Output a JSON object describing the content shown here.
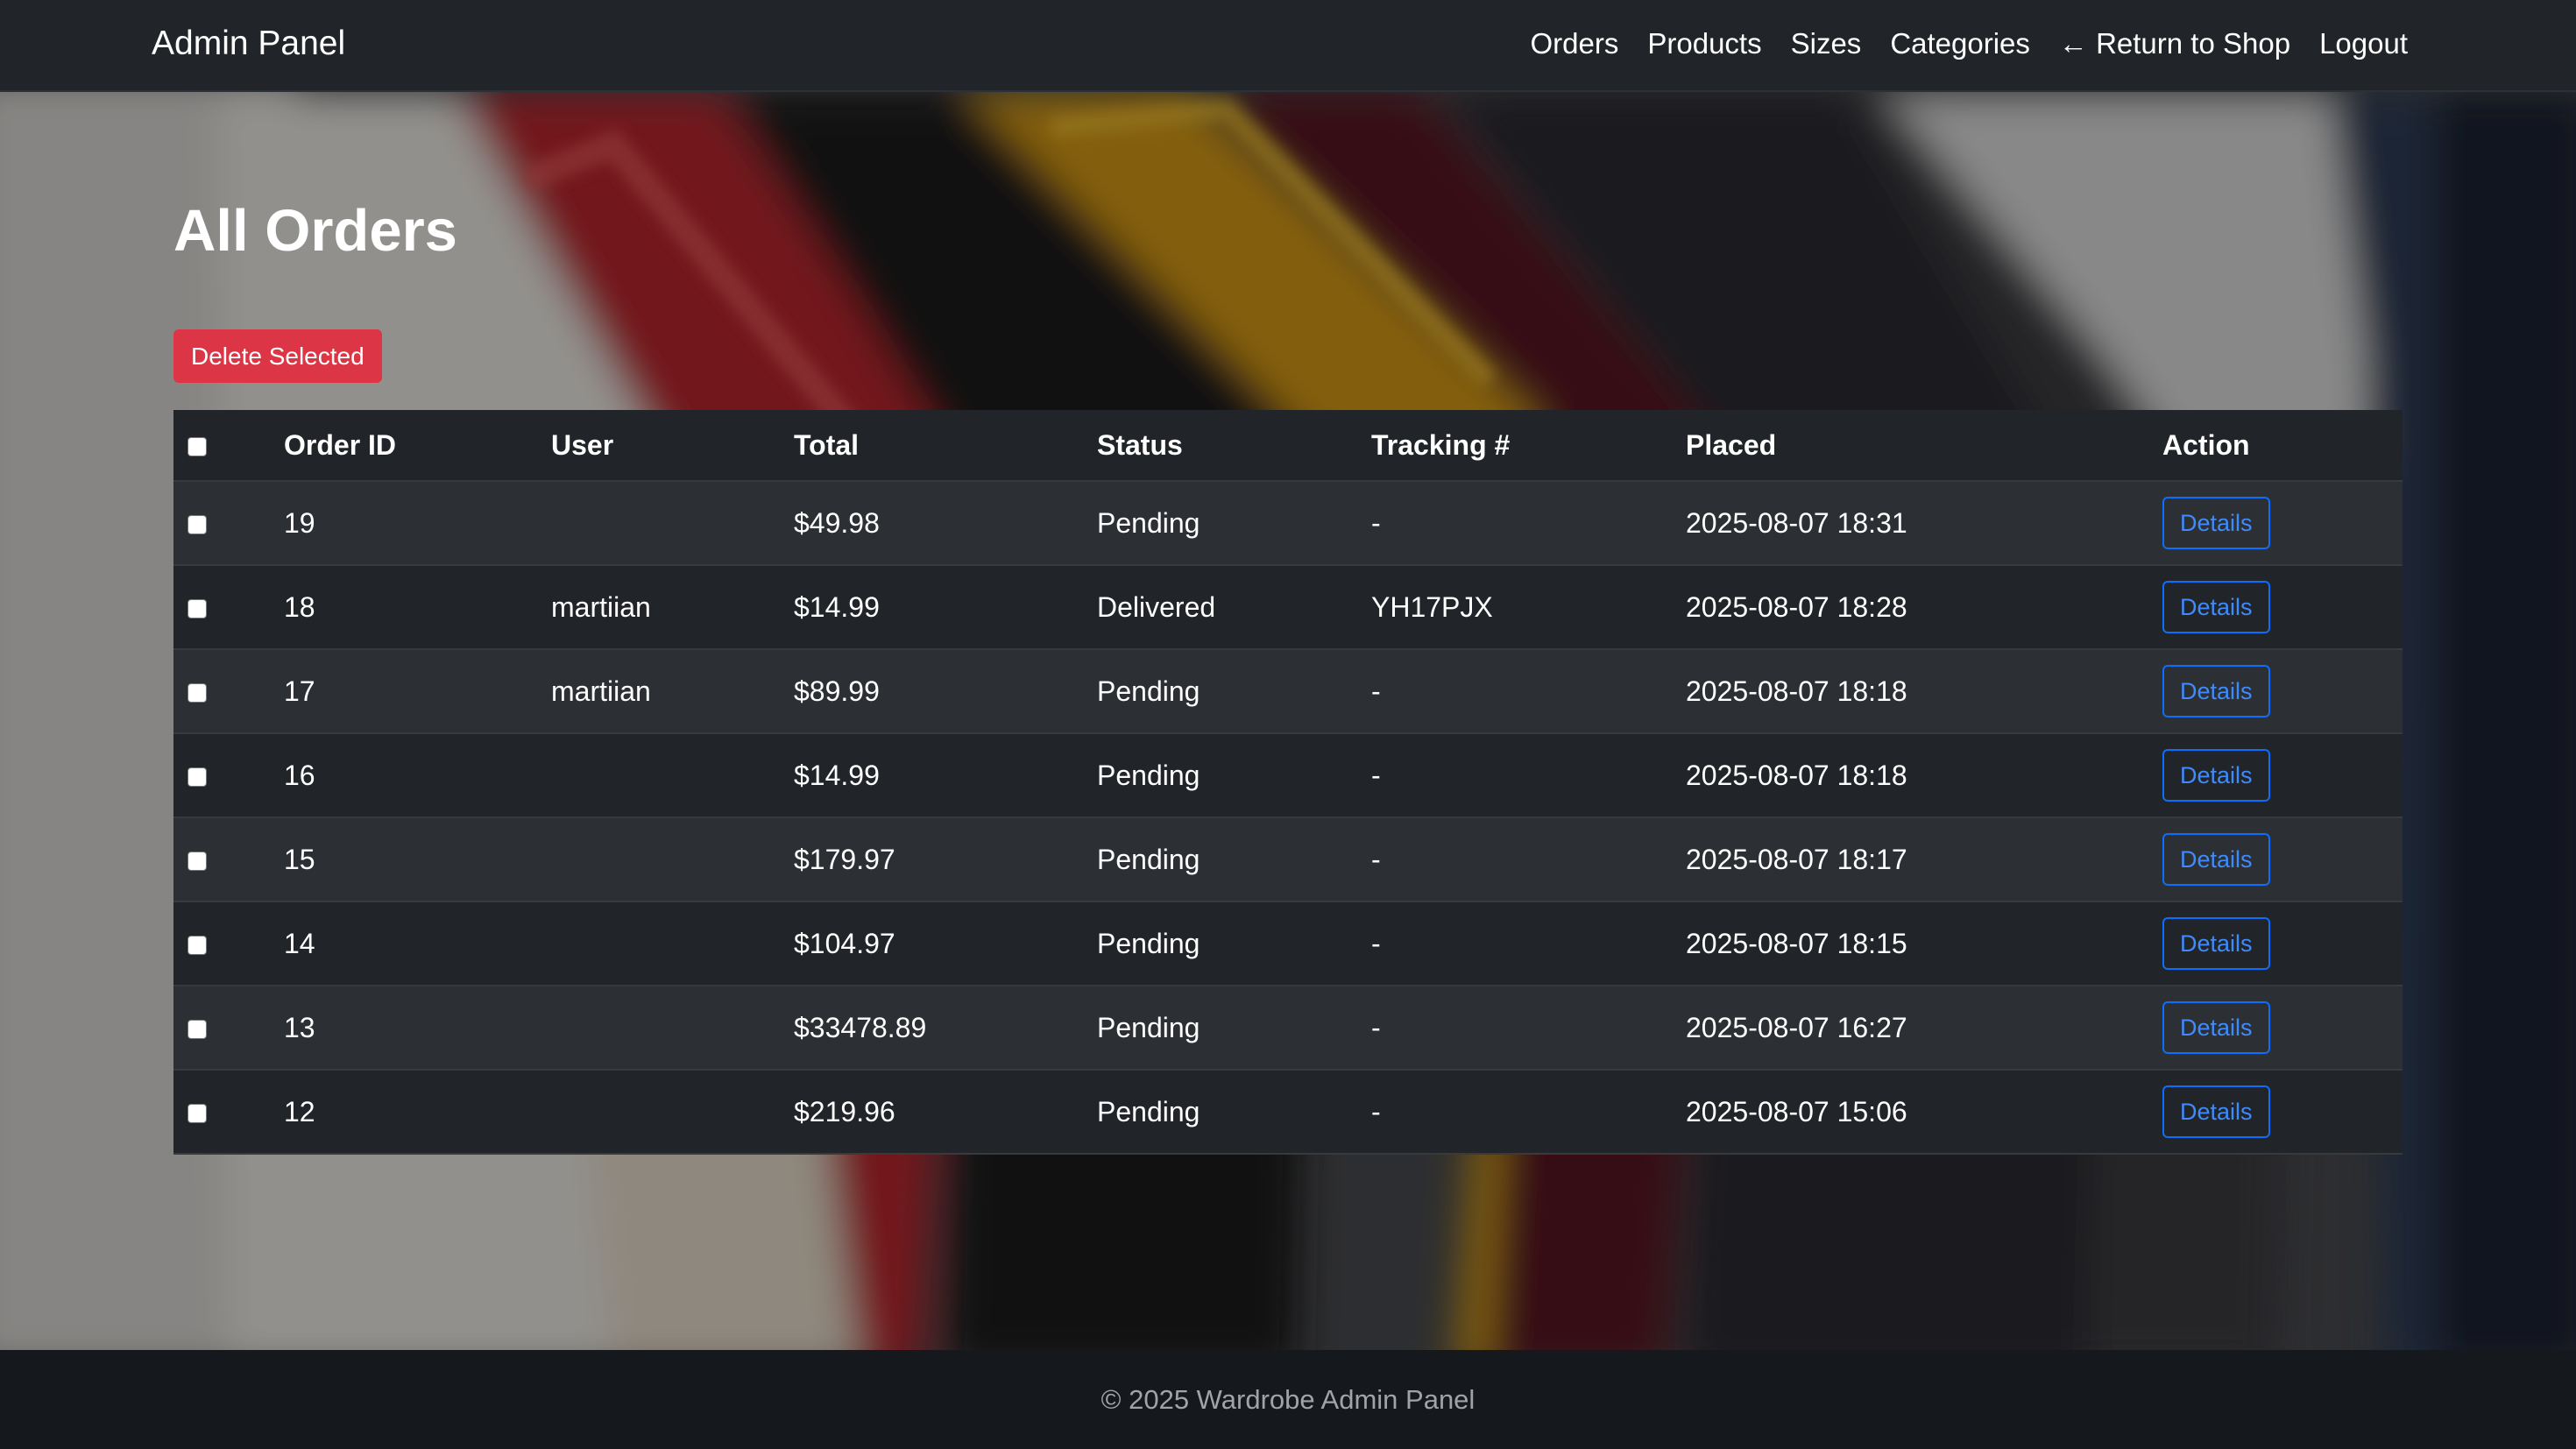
{
  "navbar": {
    "brand": "Admin Panel",
    "links": {
      "orders": "Orders",
      "products": "Products",
      "sizes": "Sizes",
      "categories": "Categories",
      "return_to_shop": "← Return to Shop",
      "logout": "Logout"
    }
  },
  "page": {
    "title": "All Orders",
    "delete_selected_label": "Delete Selected"
  },
  "table": {
    "headers": {
      "order_id": "Order ID",
      "user": "User",
      "total": "Total",
      "status": "Status",
      "tracking": "Tracking #",
      "placed": "Placed",
      "action": "Action"
    },
    "rows": [
      {
        "order_id": "19",
        "user": "",
        "total": "$49.98",
        "status": "Pending",
        "tracking": "-",
        "placed": "2025-08-07 18:31",
        "action_label": "Details"
      },
      {
        "order_id": "18",
        "user": "martiian",
        "total": "$14.99",
        "status": "Delivered",
        "tracking": "YH17PJX",
        "placed": "2025-08-07 18:28",
        "action_label": "Details"
      },
      {
        "order_id": "17",
        "user": "martiian",
        "total": "$89.99",
        "status": "Pending",
        "tracking": "-",
        "placed": "2025-08-07 18:18",
        "action_label": "Details"
      },
      {
        "order_id": "16",
        "user": "",
        "total": "$14.99",
        "status": "Pending",
        "tracking": "-",
        "placed": "2025-08-07 18:18",
        "action_label": "Details"
      },
      {
        "order_id": "15",
        "user": "",
        "total": "$179.97",
        "status": "Pending",
        "tracking": "-",
        "placed": "2025-08-07 18:17",
        "action_label": "Details"
      },
      {
        "order_id": "14",
        "user": "",
        "total": "$104.97",
        "status": "Pending",
        "tracking": "-",
        "placed": "2025-08-07 18:15",
        "action_label": "Details"
      },
      {
        "order_id": "13",
        "user": "",
        "total": "$33478.89",
        "status": "Pending",
        "tracking": "-",
        "placed": "2025-08-07 16:27",
        "action_label": "Details"
      },
      {
        "order_id": "12",
        "user": "",
        "total": "$219.96",
        "status": "Pending",
        "tracking": "-",
        "placed": "2025-08-07 15:06",
        "action_label": "Details"
      }
    ]
  },
  "footer": {
    "text": "© 2025 Wardrobe Admin Panel"
  },
  "colors": {
    "navbar_bg": "#212529",
    "danger": "#dc3545",
    "primary": "#0d6efd",
    "table_bg": "#212529",
    "table_stripe": "#2c3034",
    "footer_bg": "#15181c"
  }
}
